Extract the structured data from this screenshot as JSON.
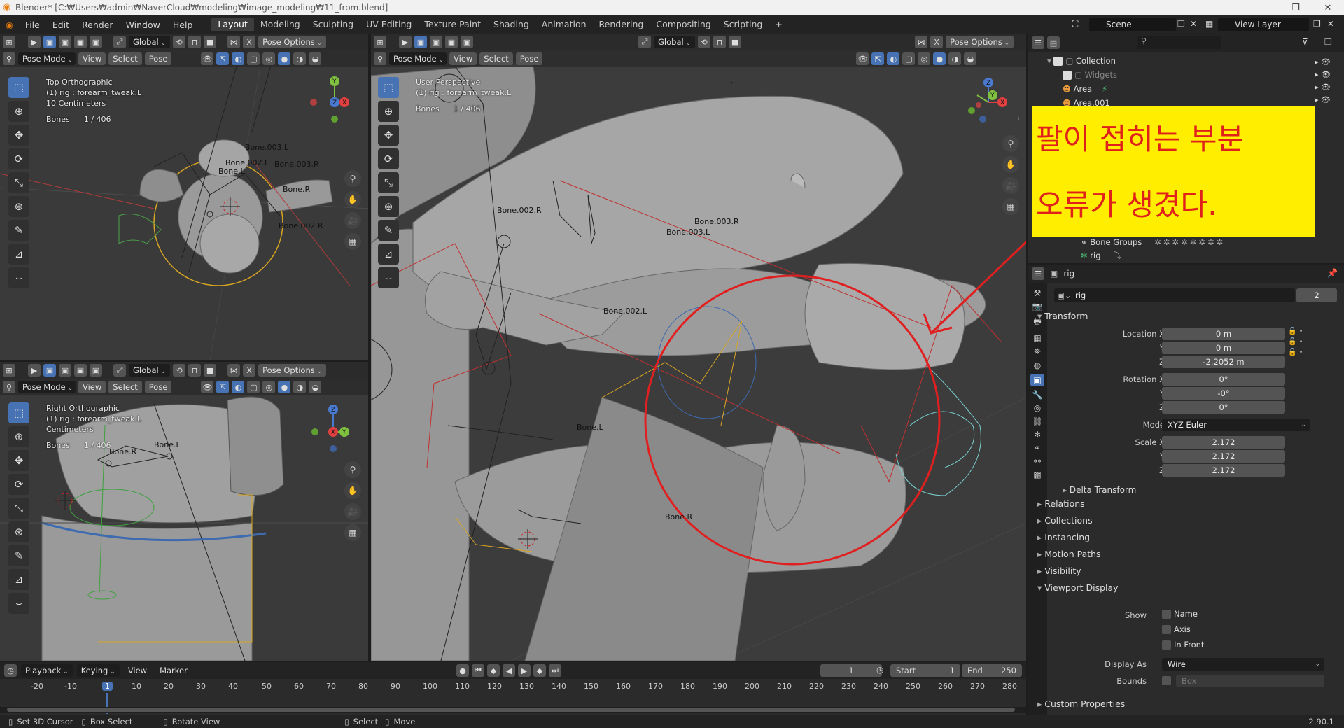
{
  "window": {
    "title": "Blender* [C:₩Users₩admin₩NaverCloud₩modeling₩image_modeling₩11_from.blend]"
  },
  "menu": [
    "File",
    "Edit",
    "Render",
    "Window",
    "Help"
  ],
  "workspaces": [
    "Layout",
    "Modeling",
    "Sculpting",
    "UV Editing",
    "Texture Paint",
    "Shading",
    "Animation",
    "Rendering",
    "Compositing",
    "Scripting"
  ],
  "scene": {
    "scene_name": "Scene",
    "view_layer": "View Layer"
  },
  "viewport_header": {
    "orientation": "Global",
    "pose_options": "Pose Options",
    "mode": "Pose Mode",
    "view": "View",
    "select": "Select",
    "pose": "Pose"
  },
  "viewport_top": {
    "line1": "Top Orthographic",
    "line2": "(1) rig : forearm_tweak.L",
    "line3": "10 Centimeters",
    "bones_label": "Bones",
    "bones_value": "1 / 406",
    "bone_labels": [
      "Bone.003.L",
      "Bone.002.L",
      "Bone.003.R",
      "Bone.L",
      "Bone.R",
      "Bone.002.R"
    ]
  },
  "viewport_right": {
    "line1": "Right Orthographic",
    "line2": "(1) rig : forearm_tweak.L",
    "line3": "Centimeters",
    "bones_label": "Bones",
    "bones_value": "1 / 406",
    "bone_labels": [
      "Bone.L",
      "Bone.R"
    ]
  },
  "viewport_main": {
    "line1": "User Perspective",
    "line2": "(1) rig : forearm_tweak.L",
    "bones_label": "Bones",
    "bones_value": "1 / 406",
    "bone_labels": [
      "Bone.002.R",
      "Bone.003.R",
      "Bone.003.L",
      "Bone.002.L",
      "Bone.L",
      "Bone.R"
    ]
  },
  "annotation": {
    "line1": "팔이 접히는 부분",
    "line2": "오류가 생겼다."
  },
  "outliner": {
    "items": [
      {
        "label": "Collection"
      },
      {
        "label": "Widgets"
      },
      {
        "label": "Area"
      },
      {
        "label": "Area.001"
      },
      {
        "label": "Bone Groups"
      },
      {
        "label": "rig"
      }
    ]
  },
  "properties": {
    "object_name": "rig",
    "header_name": "rig",
    "users": "2",
    "transform": "Transform",
    "location_x_label": "Location X",
    "location_x": "0 m",
    "location_y_label": "Y",
    "location_y": "0 m",
    "location_z_label": "Z",
    "location_z": "-2.2052 m",
    "rotation_x_label": "Rotation X",
    "rotation_x": "0°",
    "rotation_y_label": "Y",
    "rotation_y": "-0°",
    "rotation_z_label": "Z",
    "rotation_z": "0°",
    "mode_label": "Mode",
    "mode": "XYZ Euler",
    "scale_x_label": "Scale X",
    "scale_x": "2.172",
    "scale_y_label": "Y",
    "scale_y": "2.172",
    "scale_z_label": "Z",
    "scale_z": "2.172",
    "delta_transform": "Delta Transform",
    "sections": [
      "Relations",
      "Collections",
      "Instancing",
      "Motion Paths",
      "Visibility"
    ],
    "viewport_display": "Viewport Display",
    "show_label": "Show",
    "show_name": "Name",
    "show_axis": "Axis",
    "show_in_front": "In Front",
    "display_as_label": "Display As",
    "display_as": "Wire",
    "bounds_label": "Bounds",
    "bounds_value": "Box",
    "custom_properties": "Custom Properties"
  },
  "timeline": {
    "playback": "Playback",
    "keying": "Keying",
    "view": "View",
    "marker": "Marker",
    "current_frame": "1",
    "start_label": "Start",
    "start": "1",
    "end_label": "End",
    "end": "250",
    "ticks": [
      "-20",
      "-10",
      "1",
      "10",
      "20",
      "30",
      "40",
      "50",
      "60",
      "70",
      "80",
      "90",
      "100",
      "110",
      "120",
      "130",
      "140",
      "150",
      "160",
      "170",
      "180",
      "190",
      "200",
      "210",
      "220",
      "230",
      "240",
      "250",
      "260",
      "270",
      "280"
    ]
  },
  "statusbar": {
    "set_cursor": "Set 3D Cursor",
    "box_select": "Box Select",
    "rotate_view": "Rotate View",
    "select": "Select",
    "move": "Move",
    "version": "2.90.1"
  },
  "colors": {
    "accent": "#4772b3",
    "annotation_bg": "#ffee00",
    "annotation_text": "#e0201b",
    "circle": "#e02020"
  }
}
